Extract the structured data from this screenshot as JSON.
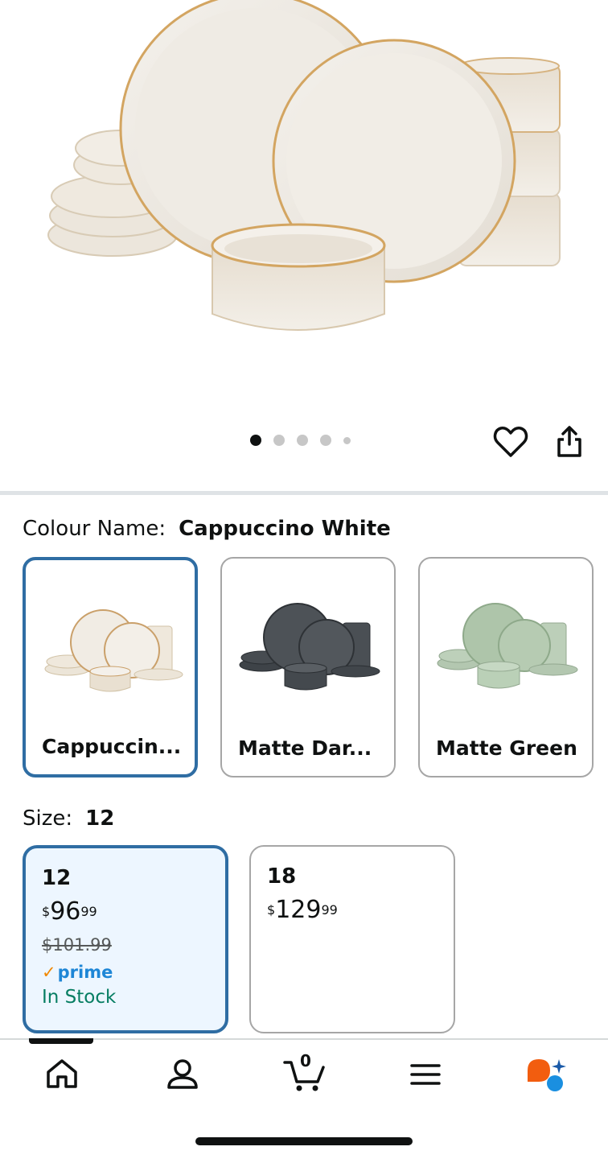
{
  "product": {
    "image_count": 5,
    "active_image": 1
  },
  "actions": {
    "wishlist_icon": "heart-outline-icon",
    "share_icon": "share-icon"
  },
  "colour": {
    "label": "Colour Name:",
    "selected": "Cappuccino White",
    "options": [
      {
        "name": "Cappuccin...",
        "selected": true,
        "tone": "#e9e3d8"
      },
      {
        "name": "Matte Dar...",
        "selected": false,
        "tone": "#4c5156"
      },
      {
        "name": "Matte Green",
        "selected": false,
        "tone": "#b9cdb6"
      }
    ]
  },
  "size": {
    "label": "Size:",
    "selected": "12",
    "options": [
      {
        "size": "12",
        "price_currency": "$",
        "price_whole": "96",
        "price_cents": "99",
        "old_price": "$101.99",
        "prime": "prime",
        "stock": "In Stock",
        "selected": true
      },
      {
        "size": "18",
        "price_currency": "$",
        "price_whole": "129",
        "price_cents": "99",
        "selected": false
      }
    ]
  },
  "nav": {
    "items": [
      "home-icon",
      "account-icon",
      "cart-icon",
      "menu-icon",
      "rufus-ai-icon"
    ],
    "cart_count": "0"
  },
  "colors": {
    "accent_border": "#2f6da3",
    "selected_bg": "#edf6ff",
    "stock_green": "#067d62",
    "prime_blue": "#1e86d6",
    "prime_check": "#f08804"
  }
}
